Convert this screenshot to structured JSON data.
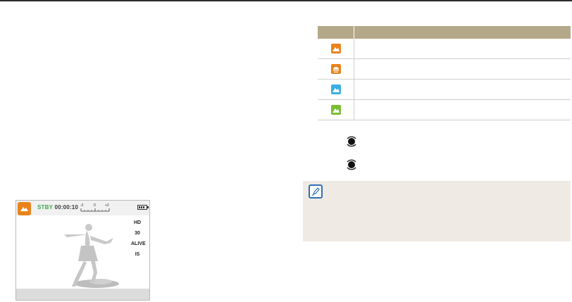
{
  "preview": {
    "status_label": "STBY",
    "record_time": "00:00:10",
    "ev_scale": [
      "-2",
      "0",
      "+2"
    ],
    "side_icons": [
      "HD",
      "30",
      "ALIVE",
      "IS"
    ]
  },
  "scene_table": {
    "rows": [
      {
        "icon": "landscape-icon",
        "color": "#e8831c"
      },
      {
        "icon": "sunset-icon",
        "color": "#e8831c"
      },
      {
        "icon": "clear-sky-icon",
        "color": "#3ab0e2"
      },
      {
        "icon": "forest-icon",
        "color": "#7bbd32"
      }
    ]
  },
  "colors": {
    "table_header": "#b4a88a",
    "note_background": "#efeae3",
    "note_icon": "#2f6fb6",
    "scene_highlight": "#e8831c"
  }
}
